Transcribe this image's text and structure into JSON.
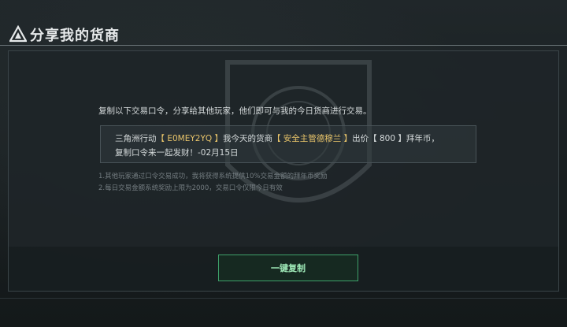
{
  "header": {
    "title": "分享我的货商"
  },
  "instruction": "复制以下交易口令，分享给其他玩家，他们即可与我的今日货商进行交易。",
  "code": {
    "line1_prefix": "三角洲行动",
    "code_value": "【 E0MEY2YQ 】",
    "line1_mid": "我今天的货商",
    "merchant": "【 安全主管德穆兰 】",
    "line1_price_prefix": "出价",
    "price": "【 800 】",
    "line1_suffix": "拜年币，",
    "line2": "复制口令来一起发财！-02月15日"
  },
  "notes": [
    "1.其他玩家通过口令交易成功，我将获得系统提供10%交易金额的拜年币奖励",
    "2.每日交易金额系统奖励上限为2000，交易口令仅限今日有效"
  ],
  "copy_button": {
    "label": "一键复制"
  },
  "colors": {
    "highlight": "#e8c46a",
    "button_border": "#3ea06a",
    "button_text": "#9fe9b8"
  }
}
